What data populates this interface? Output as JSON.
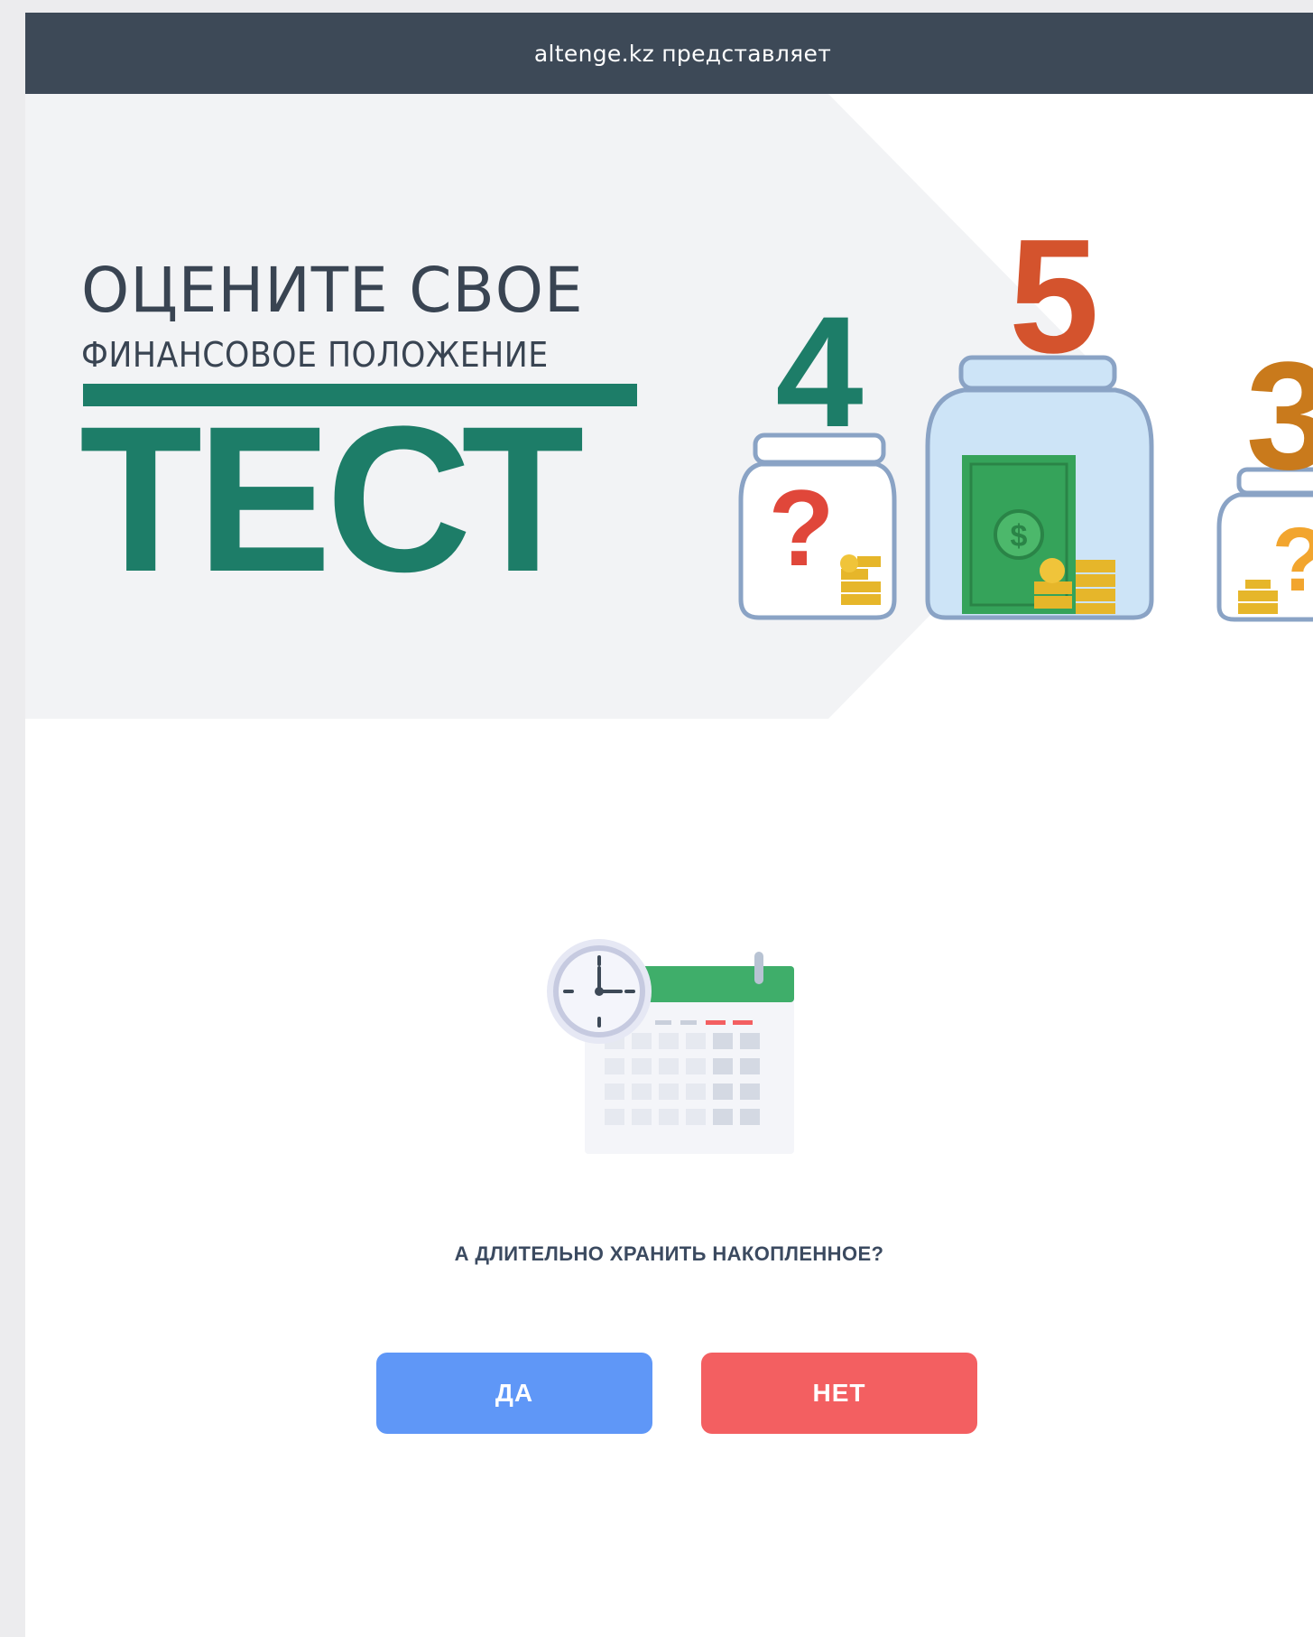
{
  "header": {
    "tagline": "altenge.kz представляет"
  },
  "hero": {
    "title_line1": "ОЦЕНИТЕ СВОЕ",
    "title_line2": "ФИНАНСОВОЕ ПОЛОЖЕНИЕ",
    "title_big": "ТЕСТ",
    "jars": [
      {
        "number": "4",
        "symbol": "?",
        "color": "#1d7d68"
      },
      {
        "number": "5",
        "symbol": "$",
        "color": "#d4532d"
      },
      {
        "number": "3",
        "symbol": "?",
        "color": "#c97a1c"
      }
    ]
  },
  "quiz": {
    "illustration": "calendar-clock-icon",
    "question": "А ДЛИТЕЛЬНО ХРАНИТЬ НАКОПЛЕННОЕ?",
    "yes_label": "ДА",
    "no_label": "НЕТ"
  },
  "colors": {
    "topbar": "#3d4957",
    "brand_green": "#1d7d68",
    "yes_button": "#5f97f7",
    "no_button": "#f35f61",
    "text_dark": "#394452"
  }
}
